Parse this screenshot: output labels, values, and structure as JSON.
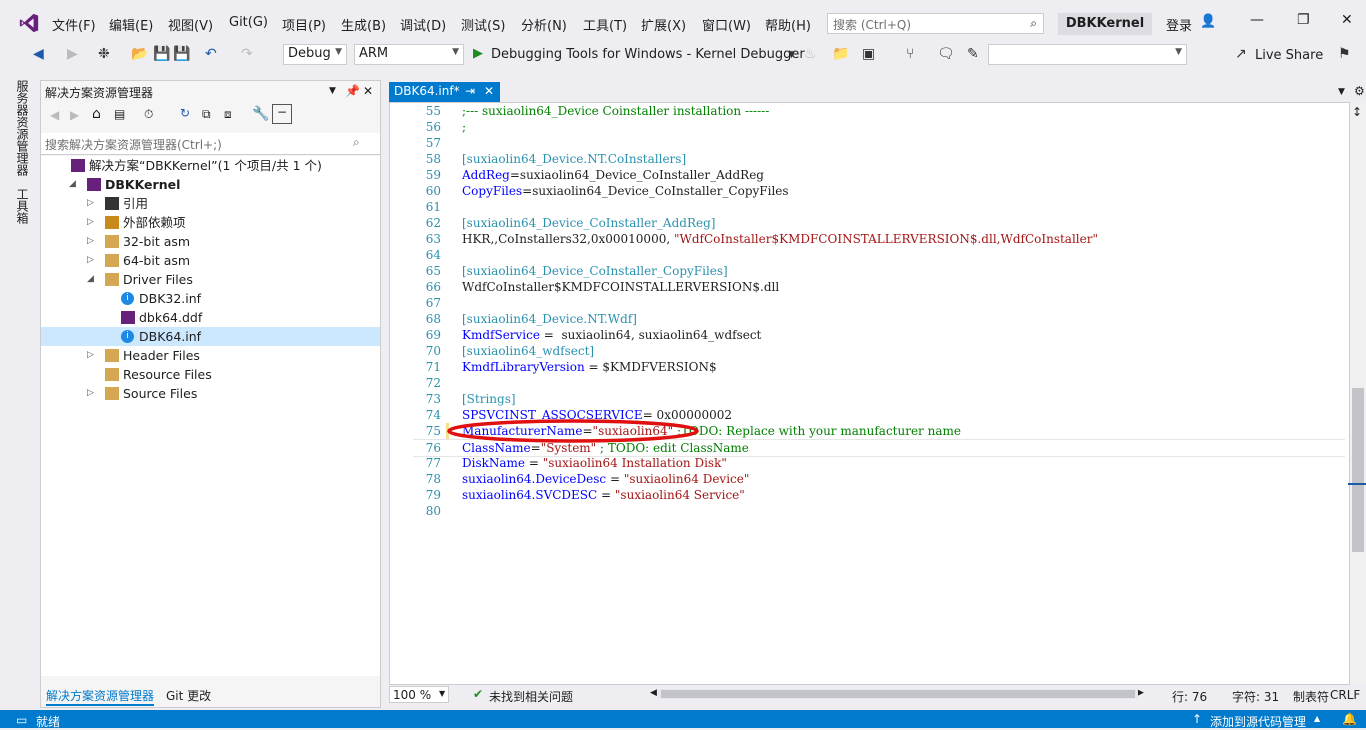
{
  "menubar": {
    "items": [
      "文件(F)",
      "编辑(E)",
      "视图(V)",
      "Git(G)",
      "项目(P)",
      "生成(B)",
      "调试(D)",
      "测试(S)",
      "分析(N)",
      "工具(T)",
      "扩展(X)",
      "窗口(W)",
      "帮助(H)"
    ],
    "search_placeholder": "搜索 (Ctrl+Q)",
    "project_title": "DBKKernel",
    "login": "登录"
  },
  "toolbar": {
    "config": "Debug",
    "platform": "ARM",
    "debugger": "Debugging Tools for Windows - Kernel Debugger",
    "live_share": "Live Share"
  },
  "vtabs": [
    "服务器资源管理器",
    "工具箱"
  ],
  "solution_explorer": {
    "title": "解决方案资源管理器",
    "search_placeholder": "搜索解决方案资源管理器(Ctrl+;)",
    "tree": [
      {
        "label": "解决方案“DBKKernel”(1 个项目/共 1 个)",
        "level": 0,
        "icon": "solution"
      },
      {
        "label": "DBKKernel",
        "level": 1,
        "icon": "project",
        "bold": true,
        "expanded": true
      },
      {
        "label": "引用",
        "level": 2,
        "icon": "references",
        "collapsed": true
      },
      {
        "label": "外部依赖项",
        "level": 2,
        "icon": "external",
        "collapsed": true
      },
      {
        "label": "32-bit asm",
        "level": 2,
        "icon": "folder",
        "collapsed": true
      },
      {
        "label": "64-bit asm",
        "level": 2,
        "icon": "folder",
        "collapsed": true
      },
      {
        "label": "Driver Files",
        "level": 2,
        "icon": "folder",
        "expanded": true
      },
      {
        "label": "DBK32.inf",
        "level": 3,
        "icon": "info"
      },
      {
        "label": "dbk64.ddf",
        "level": 3,
        "icon": "ddf"
      },
      {
        "label": "DBK64.inf",
        "level": 3,
        "icon": "info",
        "selected": true
      },
      {
        "label": "Header Files",
        "level": 2,
        "icon": "folder",
        "collapsed": true
      },
      {
        "label": "Resource Files",
        "level": 2,
        "icon": "folder"
      },
      {
        "label": "Source Files",
        "level": 2,
        "icon": "folder",
        "collapsed": true
      }
    ],
    "bottom_tabs": [
      "解决方案资源管理器",
      "Git 更改"
    ]
  },
  "editor": {
    "tab_label": "DBK64.inf*",
    "lines": [
      {
        "n": "55",
        "parts": [
          {
            "t": ";--- suxiaolin64_Device Coinstaller installation ------",
            "c": "cmt"
          }
        ]
      },
      {
        "n": "56",
        "parts": [
          {
            "t": ";",
            "c": "cmt"
          }
        ]
      },
      {
        "n": "57",
        "parts": []
      },
      {
        "n": "58",
        "parts": [
          {
            "t": "[suxiaolin64_Device.NT.CoInstallers]",
            "c": "sec"
          }
        ]
      },
      {
        "n": "59",
        "parts": [
          {
            "t": "AddReg",
            "c": "kw"
          },
          {
            "t": "=suxiaolin64_Device_CoInstaller_AddReg",
            "c": ""
          }
        ]
      },
      {
        "n": "60",
        "parts": [
          {
            "t": "CopyFiles",
            "c": "kw"
          },
          {
            "t": "=suxiaolin64_Device_CoInstaller_CopyFiles",
            "c": ""
          }
        ]
      },
      {
        "n": "61",
        "parts": []
      },
      {
        "n": "62",
        "parts": [
          {
            "t": "[suxiaolin64_Device_CoInstaller_AddReg]",
            "c": "sec"
          }
        ]
      },
      {
        "n": "63",
        "parts": [
          {
            "t": "HKR,,CoInstallers32,0x00010000, ",
            "c": ""
          },
          {
            "t": "\"WdfCoInstaller$KMDFCOINSTALLERVERSION$.dll,WdfCoInstaller\"",
            "c": "str"
          }
        ]
      },
      {
        "n": "64",
        "parts": []
      },
      {
        "n": "65",
        "parts": [
          {
            "t": "[suxiaolin64_Device_CoInstaller_CopyFiles]",
            "c": "sec"
          }
        ]
      },
      {
        "n": "66",
        "parts": [
          {
            "t": "WdfCoInstaller$KMDFCOINSTALLERVERSION$.dll",
            "c": ""
          }
        ]
      },
      {
        "n": "67",
        "parts": []
      },
      {
        "n": "68",
        "parts": [
          {
            "t": "[suxiaolin64_Device.NT.Wdf]",
            "c": "sec"
          }
        ]
      },
      {
        "n": "69",
        "parts": [
          {
            "t": "KmdfService",
            "c": "kw"
          },
          {
            "t": " =  suxiaolin64, suxiaolin64_wdfsect",
            "c": ""
          }
        ]
      },
      {
        "n": "70",
        "parts": [
          {
            "t": "[suxiaolin64_wdfsect]",
            "c": "sec"
          }
        ]
      },
      {
        "n": "71",
        "parts": [
          {
            "t": "KmdfLibraryVersion",
            "c": "kw"
          },
          {
            "t": " = $KMDFVERSION$",
            "c": ""
          }
        ]
      },
      {
        "n": "72",
        "parts": []
      },
      {
        "n": "73",
        "parts": [
          {
            "t": "[Strings]",
            "c": "sec"
          }
        ]
      },
      {
        "n": "74",
        "parts": [
          {
            "t": "SPSVCINST_ASSOCSERVICE",
            "c": "kw"
          },
          {
            "t": "= 0x00000002",
            "c": ""
          }
        ]
      },
      {
        "n": "75",
        "parts": [
          {
            "t": "ManufacturerName",
            "c": "kw"
          },
          {
            "t": "=",
            "c": ""
          },
          {
            "t": "\"suxiaolin64\"",
            "c": "str"
          },
          {
            "t": " ;TODO: Replace with your manufacturer name",
            "c": "cmt"
          }
        ]
      },
      {
        "n": "76",
        "parts": [
          {
            "t": "ClassName",
            "c": "kw"
          },
          {
            "t": "=",
            "c": ""
          },
          {
            "t": "\"System\"",
            "c": "str"
          },
          {
            "t": " ; TODO: edit ClassName",
            "c": "cmt"
          }
        ]
      },
      {
        "n": "77",
        "parts": [
          {
            "t": "DiskName",
            "c": "kw"
          },
          {
            "t": " = ",
            "c": ""
          },
          {
            "t": "\"suxiaolin64 Installation Disk\"",
            "c": "str"
          }
        ]
      },
      {
        "n": "78",
        "parts": [
          {
            "t": "suxiaolin64.DeviceDesc",
            "c": "kw"
          },
          {
            "t": " = ",
            "c": ""
          },
          {
            "t": "\"suxiaolin64 Device\"",
            "c": "str"
          }
        ]
      },
      {
        "n": "79",
        "parts": [
          {
            "t": "suxiaolin64.SVCDESC",
            "c": "kw"
          },
          {
            "t": " = ",
            "c": ""
          },
          {
            "t": "\"suxiaolin64 Service\"",
            "c": "str"
          }
        ]
      },
      {
        "n": "80",
        "parts": []
      }
    ],
    "zoom": "100 %",
    "issues": "未找到相关问题",
    "line_info": "行: 76",
    "col_info": "字符: 31",
    "tab_info": "制表符",
    "eol": "CRLF"
  },
  "statusbar": {
    "ready": "就绪",
    "source_control": "添加到源代码管理"
  },
  "colors": {
    "accent": "#007acc",
    "annotation": "#e01010"
  }
}
